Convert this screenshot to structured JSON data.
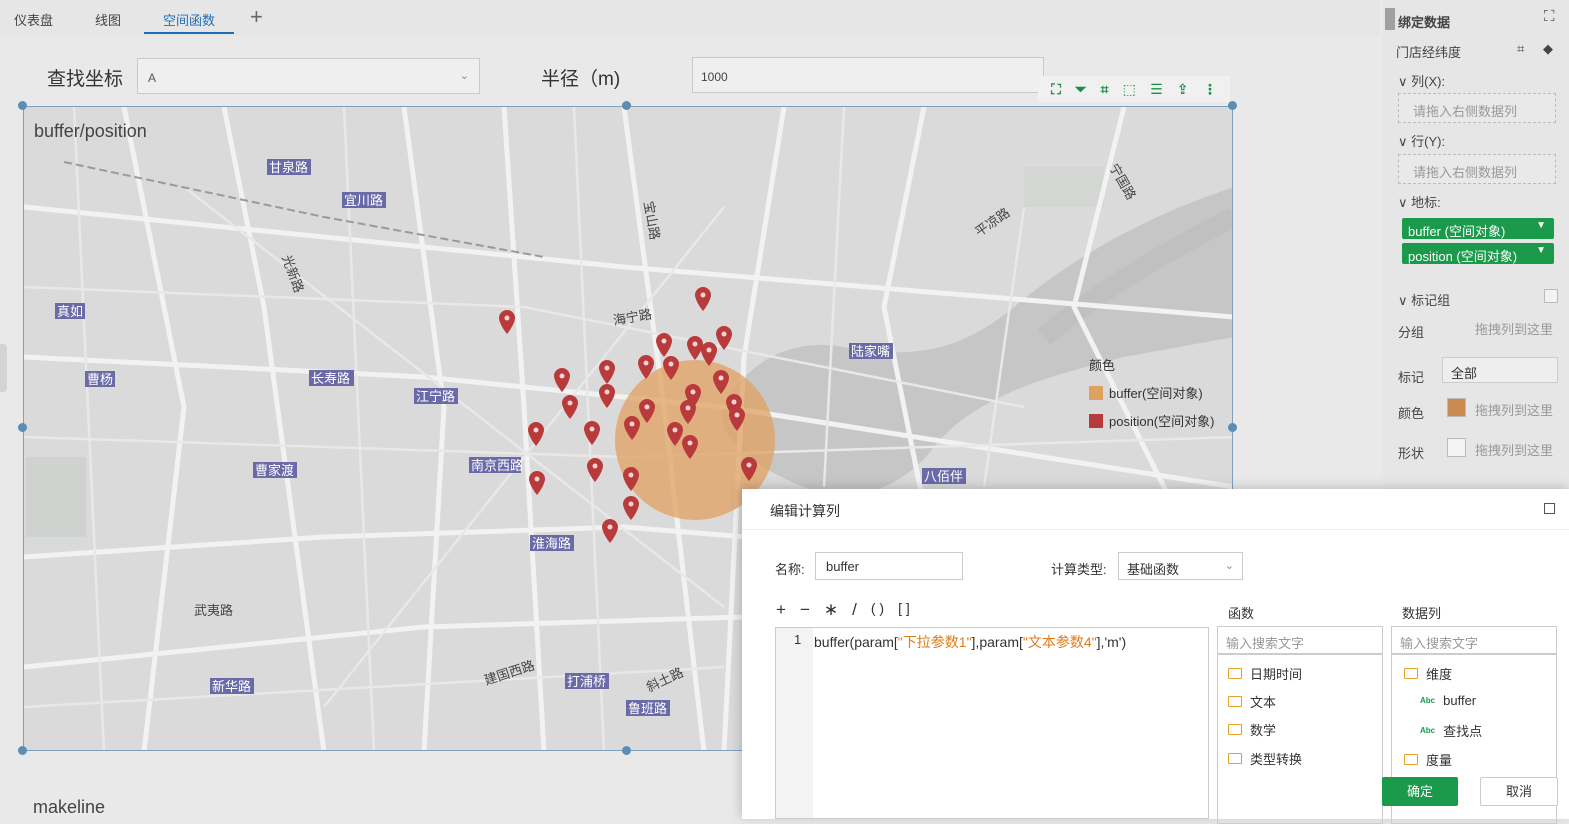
{
  "tabs": [
    {
      "label": "仪表盘"
    },
    {
      "label": "线图"
    },
    {
      "label": "空间函数"
    }
  ],
  "params": {
    "coord_label": "查找坐标",
    "coord_value": "A",
    "radius_label": "半径（m)",
    "radius_value": "1000"
  },
  "widget": {
    "title": "buffer/position",
    "legend_title": "颜色",
    "legend": [
      {
        "label": "buffer(空间对象)",
        "color": "#e0a060"
      },
      {
        "label": "position(空间对象)",
        "color": "#b93a3a"
      }
    ],
    "map_labels": [
      "甘泉路",
      "宜川路",
      "光新路",
      "真如",
      "曹杨",
      "长寿路",
      "江宁路",
      "曹家渡",
      "南京西路",
      "淮海路",
      "武夷路",
      "新华路",
      "建国西路",
      "打浦桥",
      "斜土路",
      "鲁班路",
      "海宁路",
      "宝山路",
      "陆家嘴",
      "八佰伴",
      "平凉路",
      "宁国路"
    ]
  },
  "second_widget_title": "makeline",
  "right_panel": {
    "header": "绑定数据",
    "dataset": "门店经纬度",
    "col_label": "列(X):",
    "col_placeholder": "请拖入右侧数据列",
    "row_label": "行(Y):",
    "row_placeholder": "请拖入右侧数据列",
    "geo_label": "地标:",
    "geo_pills": [
      "buffer (空间对象)",
      "position (空间对象)"
    ],
    "mark_group": "标记组",
    "group_label": "分组",
    "group_drop": "拖拽列到这里",
    "mark_label": "标记",
    "mark_value": "全部",
    "color_label": "颜色",
    "color_drop": "拖拽列到这里",
    "shape_label": "形状",
    "shape_drop": "拖拽列到这里"
  },
  "dialog": {
    "title": "编辑计算列",
    "name_label": "名称:",
    "name_value": "buffer",
    "type_label": "计算类型:",
    "type_value": "基础函数",
    "ops": [
      "+",
      "−",
      "∗",
      "/",
      "( )",
      "[ ]"
    ],
    "line_no": "1",
    "code_prefix": "buffer(param[",
    "code_q1": "\"",
    "code_s1": "下拉参数1",
    "code_mid": "],param[",
    "code_s2": "文本参数4",
    "code_end": "],'m')",
    "functions_header": "函数",
    "func_search": "输入搜索文字",
    "functions": [
      "日期时间",
      "文本",
      "数学",
      "类型转换"
    ],
    "columns_header": "数据列",
    "col_search": "输入搜索文字",
    "dimension": "维度",
    "dim_items": [
      "buffer",
      "查找点"
    ],
    "measure": "度量",
    "ok": "确定",
    "cancel": "取消"
  }
}
